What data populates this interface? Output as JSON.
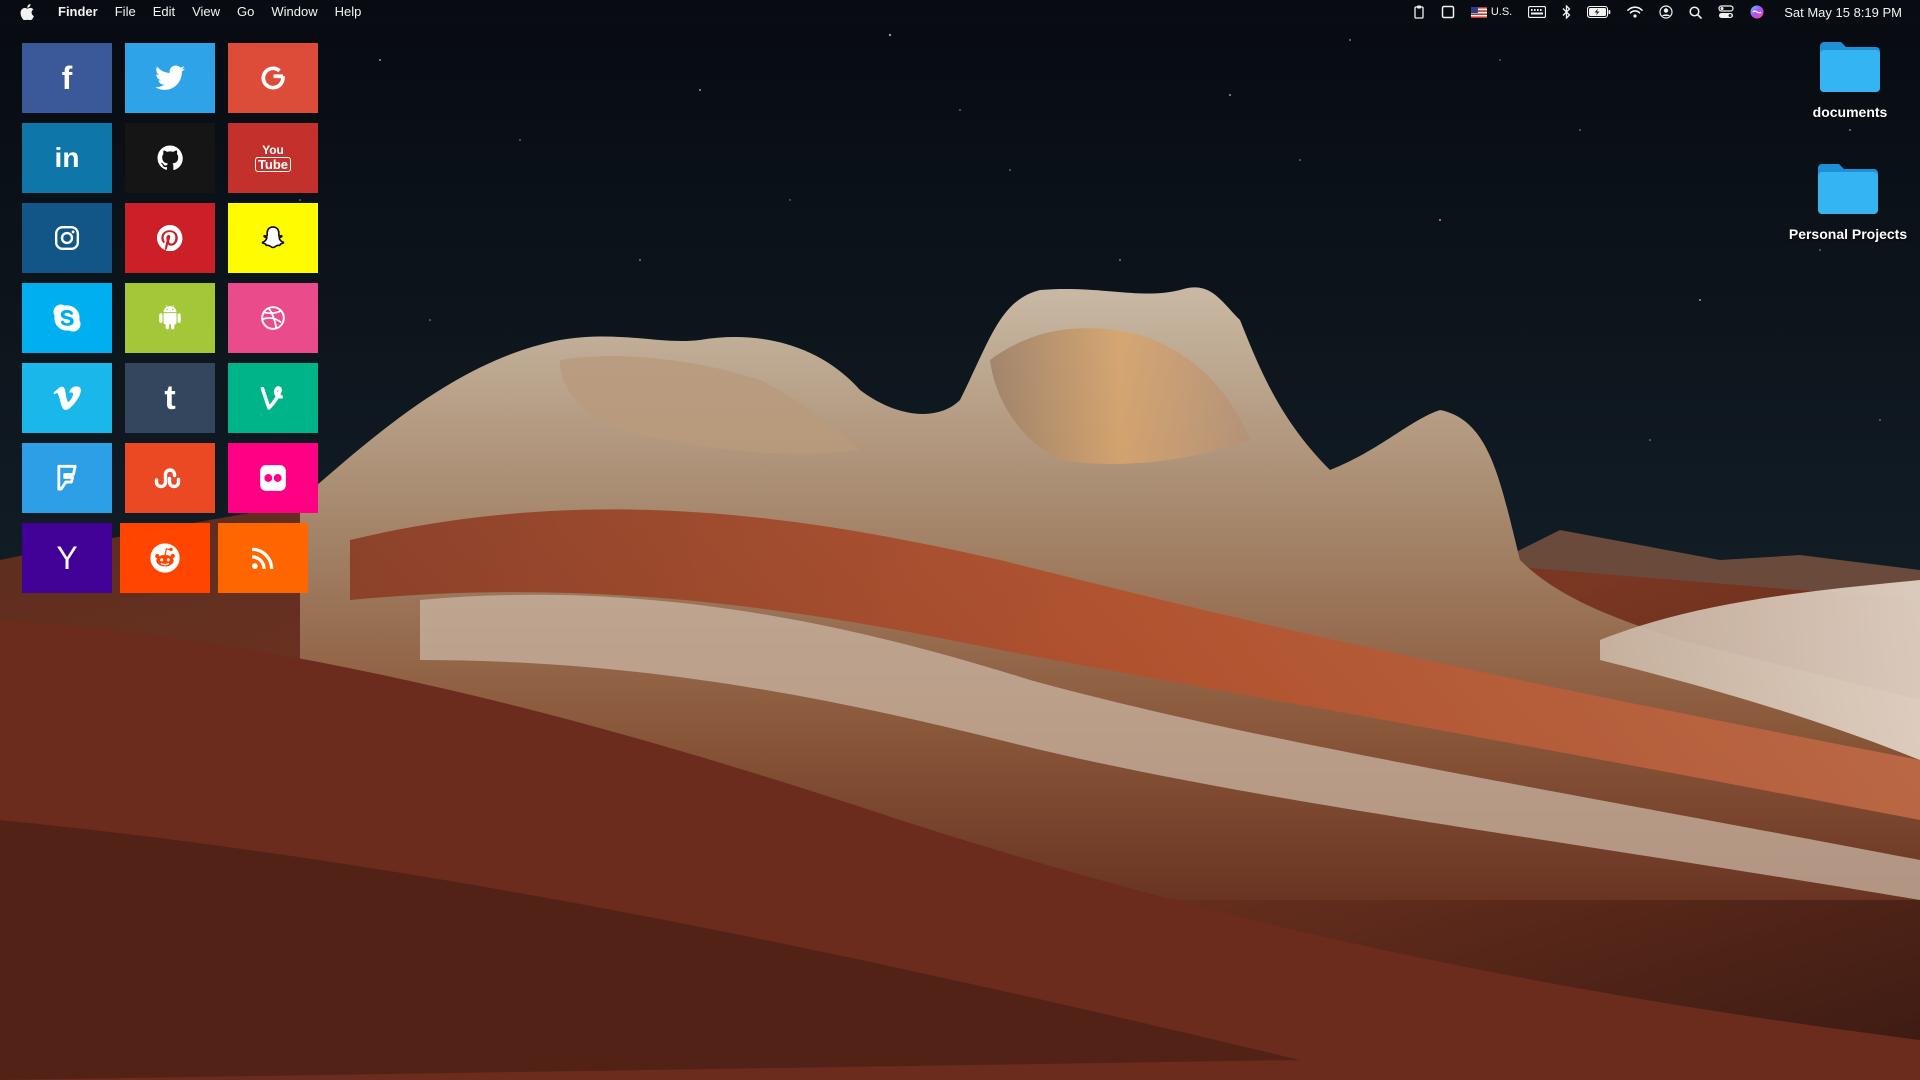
{
  "menubar": {
    "app_name": "Finder",
    "menus": [
      "File",
      "Edit",
      "View",
      "Go",
      "Window",
      "Help"
    ],
    "status_icons": [
      "clipboard-icon",
      "window-icon",
      "us-flag-icon",
      "keyboard-icon",
      "bluetooth-icon",
      "battery-charging-icon",
      "wifi-icon",
      "user-icon",
      "search-icon",
      "control-center-icon",
      "siri-icon"
    ],
    "input_source_label": "U.S.",
    "clock": "Sat May 15  8:19 PM"
  },
  "social_tiles": [
    {
      "name": "facebook",
      "color": "#3b5998",
      "icon": "facebook-icon"
    },
    {
      "name": "twitter",
      "color": "#2ea3e8",
      "icon": "twitter-icon"
    },
    {
      "name": "google",
      "color": "#dd4b39",
      "icon": "google-icon"
    },
    {
      "name": "linkedin",
      "color": "#0e76a8",
      "icon": "linkedin-icon"
    },
    {
      "name": "github",
      "color": "#151515",
      "icon": "github-icon"
    },
    {
      "name": "youtube",
      "color": "#c4302b",
      "icon": "youtube-icon"
    },
    {
      "name": "instagram",
      "color": "#125688",
      "icon": "instagram-icon"
    },
    {
      "name": "pinterest",
      "color": "#cb2027",
      "icon": "pinterest-icon"
    },
    {
      "name": "snapchat",
      "color": "#fffc00",
      "icon": "snapchat-icon"
    },
    {
      "name": "skype",
      "color": "#00aff0",
      "icon": "skype-icon"
    },
    {
      "name": "android",
      "color": "#a4c639",
      "icon": "android-icon"
    },
    {
      "name": "dribbble",
      "color": "#ea4c89",
      "icon": "dribbble-icon"
    },
    {
      "name": "vimeo",
      "color": "#1ab7ea",
      "icon": "vimeo-icon"
    },
    {
      "name": "tumblr",
      "color": "#34465d",
      "icon": "tumblr-icon"
    },
    {
      "name": "vine",
      "color": "#00b489",
      "icon": "vine-icon"
    },
    {
      "name": "foursquare",
      "color": "#2d9fe6",
      "icon": "foursquare-icon"
    },
    {
      "name": "stumbleupon",
      "color": "#eb4924",
      "icon": "stumbleupon-icon"
    },
    {
      "name": "flickr",
      "color": "#ff0084",
      "icon": "flickr-icon"
    },
    {
      "name": "yahoo",
      "color": "#430297",
      "icon": "yahoo-icon"
    },
    {
      "name": "reddit",
      "color": "#ff4500",
      "icon": "reddit-icon"
    },
    {
      "name": "rss",
      "color": "#ff6600",
      "icon": "rss-icon"
    }
  ],
  "desktop_folders": [
    {
      "label": "documents",
      "color": "#2aa9ec"
    },
    {
      "label": "Personal Projects",
      "color": "#2aa9ec"
    }
  ],
  "tile_glyphs": {
    "facebook": "f",
    "linkedin": "in",
    "tumblr": "t",
    "yahoo": "Y",
    "youtube_top": "You",
    "youtube_bottom": "Tube"
  }
}
